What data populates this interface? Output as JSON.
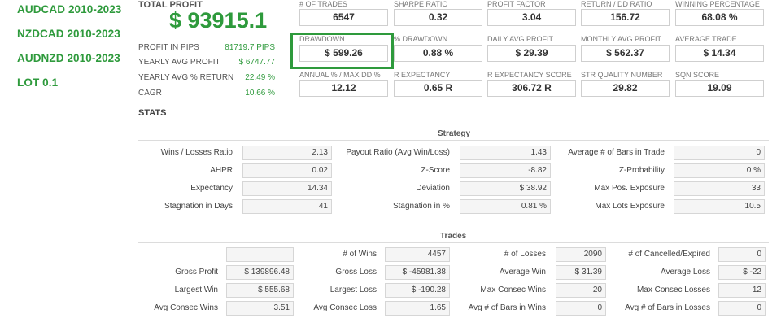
{
  "sidebar": {
    "pairs": [
      "AUDCAD 2010-2023",
      "NZDCAD 2010-2023",
      "AUDNZD 2010-2023"
    ],
    "lot": "LOT 0.1"
  },
  "summary": {
    "total_profit_label": "TOTAL PROFIT",
    "total_profit_value": "$ 93915.1",
    "rows": [
      {
        "label": "PROFIT IN PIPS",
        "value": "81719.7 PIPS"
      },
      {
        "label": "YEARLY AVG PROFIT",
        "value": "$ 6747.77"
      },
      {
        "label": "YEARLY AVG % RETURN",
        "value": "22.49 %"
      },
      {
        "label": "CAGR",
        "value": "10.66 %"
      }
    ]
  },
  "metrics": [
    {
      "label": "# OF TRADES",
      "value": "6547"
    },
    {
      "label": "SHARPE RATIO",
      "value": "0.32"
    },
    {
      "label": "PROFIT FACTOR",
      "value": "3.04"
    },
    {
      "label": "RETURN / DD RATIO",
      "value": "156.72"
    },
    {
      "label": "WINNING PERCENTAGE",
      "value": "68.08 %"
    },
    {
      "label": "DRAWDOWN",
      "value": "$ 599.26"
    },
    {
      "label": "% DRAWDOWN",
      "value": "0.88 %"
    },
    {
      "label": "DAILY AVG PROFIT",
      "value": "$ 29.39"
    },
    {
      "label": "MONTHLY AVG PROFIT",
      "value": "$ 562.37"
    },
    {
      "label": "AVERAGE TRADE",
      "value": "$ 14.34"
    },
    {
      "label": "ANNUAL % / MAX DD %",
      "value": "12.12"
    },
    {
      "label": "R EXPECTANCY",
      "value": "0.65 R"
    },
    {
      "label": "R EXPECTANCY SCORE",
      "value": "306.72 R"
    },
    {
      "label": "STR QUALITY NUMBER",
      "value": "29.82"
    },
    {
      "label": "SQN SCORE",
      "value": "19.09"
    }
  ],
  "stats": {
    "title": "STATS",
    "strategy": {
      "title": "Strategy",
      "rows": [
        [
          {
            "label": "Wins / Losses Ratio",
            "value": "2.13"
          },
          {
            "label": "Payout Ratio (Avg Win/Loss)",
            "value": "1.43"
          },
          {
            "label": "Average # of Bars in Trade",
            "value": "0"
          }
        ],
        [
          {
            "label": "AHPR",
            "value": "0.02"
          },
          {
            "label": "Z-Score",
            "value": "-8.82"
          },
          {
            "label": "Z-Probability",
            "value": "0 %"
          }
        ],
        [
          {
            "label": "Expectancy",
            "value": "14.34"
          },
          {
            "label": "Deviation",
            "value": "$ 38.92"
          },
          {
            "label": "Max Pos. Exposure",
            "value": "33"
          }
        ],
        [
          {
            "label": "Stagnation in Days",
            "value": "41"
          },
          {
            "label": "Stagnation in %",
            "value": "0.81 %"
          },
          {
            "label": "Max Lots Exposure",
            "value": "10.5"
          }
        ]
      ]
    },
    "trades": {
      "title": "Trades",
      "rows": [
        [
          {
            "label": "",
            "value": ""
          },
          {
            "label": "# of Wins",
            "value": "4457"
          },
          {
            "label": "# of Losses",
            "value": "2090"
          },
          {
            "label": "# of Cancelled/Expired",
            "value": "0"
          }
        ],
        [
          {
            "label": "Gross Profit",
            "value": "$ 139896.48"
          },
          {
            "label": "Gross Loss",
            "value": "$ -45981.38"
          },
          {
            "label": "Average Win",
            "value": "$ 31.39"
          },
          {
            "label": "Average Loss",
            "value": "$ -22"
          }
        ],
        [
          {
            "label": "Largest Win",
            "value": "$ 555.68"
          },
          {
            "label": "Largest Loss",
            "value": "$ -190.28"
          },
          {
            "label": "Max Consec Wins",
            "value": "20"
          },
          {
            "label": "Max Consec Losses",
            "value": "12"
          }
        ],
        [
          {
            "label": "Avg Consec Wins",
            "value": "3.51"
          },
          {
            "label": "Avg Consec Loss",
            "value": "1.65"
          },
          {
            "label": "Avg # of Bars in Wins",
            "value": "0"
          },
          {
            "label": "Avg # of Bars in Losses",
            "value": "0"
          }
        ]
      ]
    }
  }
}
